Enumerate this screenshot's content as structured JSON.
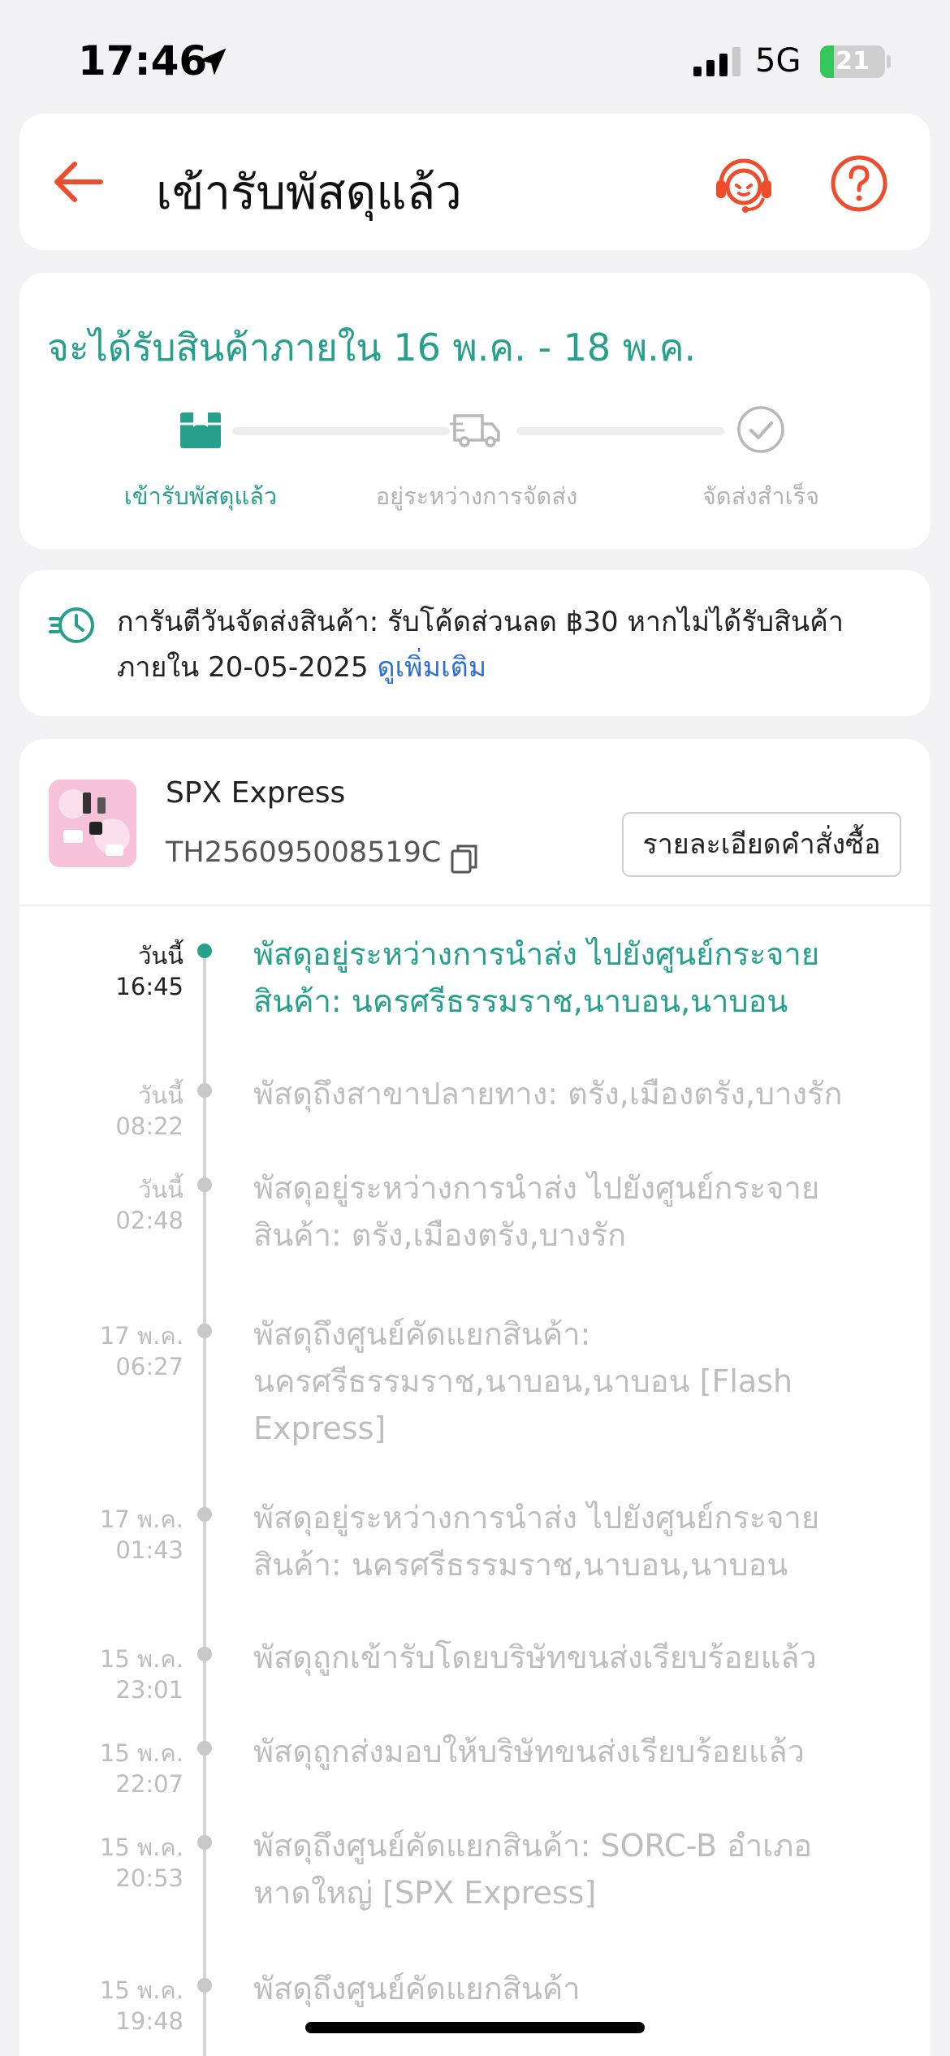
{
  "status_bar": {
    "time": "17:46",
    "network": "5G",
    "battery": "21",
    "battery_level": 0.21
  },
  "header": {
    "title": "เข้ารับพัสดุแล้ว"
  },
  "estimate": {
    "title": "จะได้รับสินค้าภายใน 16 พ.ค. - 18 พ.ค.",
    "steps": [
      {
        "label": "เข้ารับพัสดุแล้ว",
        "active": true
      },
      {
        "label": "อยู่ระหว่างการจัดส่ง",
        "active": false
      },
      {
        "label": "จัดส่งสำเร็จ",
        "active": false
      }
    ]
  },
  "guarantee": {
    "text": "การันตีวันจัดส่งสินค้า: รับโค้ดส่วนลด ฿30 หากไม่ได้รับสินค้าภายใน 20-05-2025 ",
    "link": "ดูเพิ่มเติม"
  },
  "shipment": {
    "carrier": "SPX Express",
    "tracking_number": "TH256095008519C",
    "order_details_label": "รายละเอียดคำสั่งซื้อ"
  },
  "events": [
    {
      "day": "วันนี้",
      "time": "16:45",
      "text": "พัสดุอยู่ระหว่างการนำส่ง  ไปยังศูนย์กระจายสินค้า: นครศรีธรรมราช,นาบอน,นาบอน",
      "active": true
    },
    {
      "day": "วันนี้",
      "time": "08:22",
      "text": "พัสดุถึงสาขาปลายทาง: ตรัง,เมืองตรัง,บางรัก",
      "active": false
    },
    {
      "day": "วันนี้",
      "time": "02:48",
      "text": "พัสดุอยู่ระหว่างการนำส่ง  ไปยังศูนย์กระจายสินค้า: ตรัง,เมืองตรัง,บางรัก",
      "active": false
    },
    {
      "day": "17 พ.ค.",
      "time": "06:27",
      "text": "พัสดุถึงศูนย์คัดแยกสินค้า: นครศรีธรรมราช,นาบอน,นาบอน  [Flash Express]",
      "active": false
    },
    {
      "day": "17 พ.ค.",
      "time": "01:43",
      "text": "พัสดุอยู่ระหว่างการนำส่ง  ไปยังศูนย์กระจายสินค้า: นครศรีธรรมราช,นาบอน,นาบอน",
      "active": false
    },
    {
      "day": "15 พ.ค.",
      "time": "23:01",
      "text": "พัสดุถูกเข้ารับโดยบริษัทขนส่งเรียบร้อยแล้ว",
      "active": false
    },
    {
      "day": "15 พ.ค.",
      "time": "22:07",
      "text": "พัสดุถูกส่งมอบให้บริษัทขนส่งเรียบร้อยแล้ว",
      "active": false
    },
    {
      "day": "15 พ.ค.",
      "time": "20:53",
      "text": "พัสดุถึงศูนย์คัดแยกสินค้า: SORC-B อำเภอหาดใหญ่ [SPX Express]",
      "active": false
    },
    {
      "day": "15 พ.ค.",
      "time": "19:48",
      "text": "พัสดุถึงศูนย์คัดแยกสินค้า",
      "active": false
    }
  ],
  "colors": {
    "accent": "#26a08d",
    "brand": "#ee4d2d",
    "link": "#2d6fd8"
  }
}
